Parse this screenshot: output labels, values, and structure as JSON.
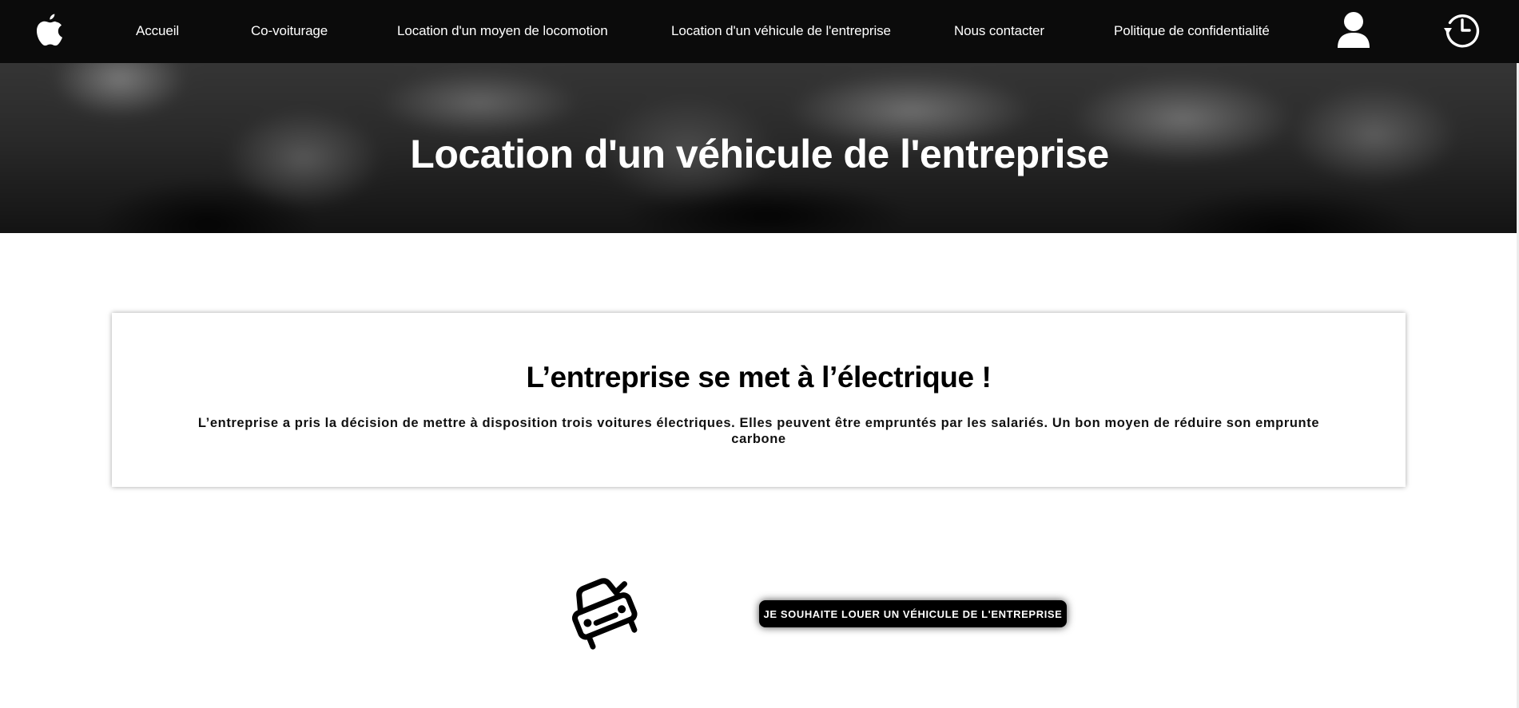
{
  "nav": {
    "logo_icon": "apple-icon",
    "links": [
      {
        "label": "Accueil"
      },
      {
        "label": "Co-voiturage"
      },
      {
        "label": "Location d'un moyen de locomotion"
      },
      {
        "label": "Location d'un véhicule de l'entreprise"
      },
      {
        "label": "Nous contacter"
      },
      {
        "label": "Politique de confidentialité"
      }
    ],
    "user_icon": "user-icon",
    "history_icon": "history-icon"
  },
  "hero": {
    "title": "Location d'un véhicule de l'entreprise"
  },
  "card": {
    "title": "L’entreprise se met à l’électrique !",
    "text": "L’entreprise a pris la décision de mettre à disposition trois voitures électriques. Elles peuvent être empruntés par les salariés. Un bon moyen de réduire son emprunte carbone"
  },
  "action": {
    "car_icon": "car-icon",
    "button_label": "JE SOUHAITE LOUER UN VÉHICULE DE L'ENTREPRISE"
  },
  "colors": {
    "nav_background": "#0b0b0b",
    "button_background": "#000000",
    "text_on_dark": "#ffffff"
  }
}
